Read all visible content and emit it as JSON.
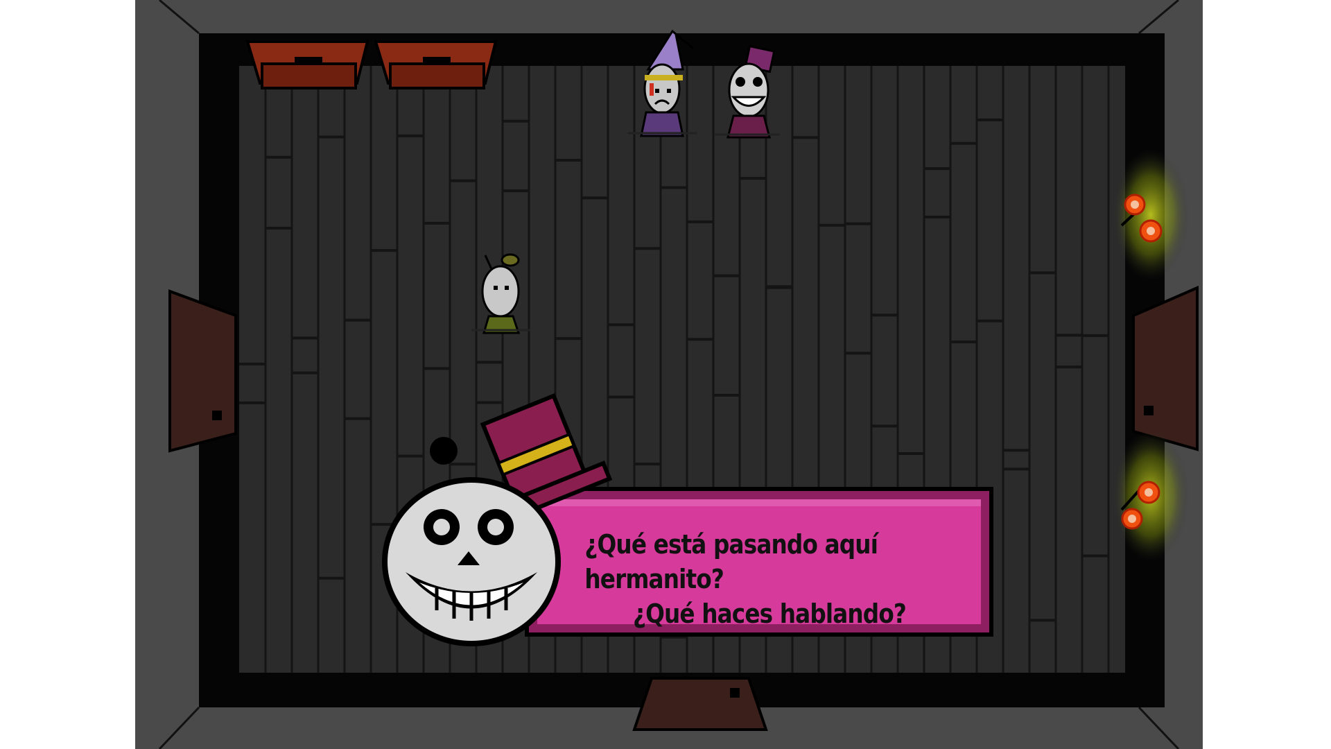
{
  "colors": {
    "outer_wall": "#4a4a4a",
    "inner_border": "#050505",
    "floor": "#2b2b2b",
    "floor_lines": "#141414",
    "door": "#3a1f1a",
    "chest": "#8a2a14",
    "dialog_pink": "#d63a9a",
    "dialog_dark": "#8e1f60",
    "face_white": "#d9d9d9",
    "hat": "#8a1f4f",
    "hat_band": "#d6b21a",
    "torch_glow": "#b0c020",
    "torch_fire": "#f05010"
  },
  "dialog": {
    "line1": "¿Qué está pasando aquí hermanito?",
    "line2": "¿Qué haces hablando?"
  },
  "characters": [
    {
      "name": "witch-hat-puppet"
    },
    {
      "name": "top-hat-puppet"
    },
    {
      "name": "bowler-hat-puppet"
    }
  ]
}
